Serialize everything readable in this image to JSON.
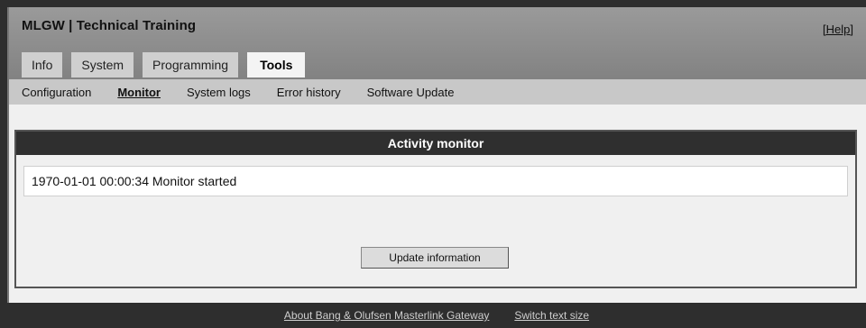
{
  "header": {
    "title": "MLGW | Technical Training",
    "help_label": "[Help]"
  },
  "tabs": [
    {
      "label": "Info"
    },
    {
      "label": "System"
    },
    {
      "label": "Programming"
    },
    {
      "label": "Tools",
      "active": true
    }
  ],
  "subnav": [
    {
      "label": "Configuration"
    },
    {
      "label": "Monitor",
      "active": true
    },
    {
      "label": "System logs"
    },
    {
      "label": "Error history"
    },
    {
      "label": "Software Update"
    }
  ],
  "panel": {
    "title": "Activity monitor",
    "log_entries": [
      "1970-01-01 00:00:34 Monitor started"
    ],
    "update_button_label": "Update information"
  },
  "footer": {
    "about_link": "About Bang & Olufsen Masterlink Gateway",
    "text_size_link": "Switch text size"
  },
  "colors": {
    "header_gradient_top": "#9a9a9a",
    "panel_header": "#2f2f2f",
    "page_background": "#2e2e2e"
  }
}
